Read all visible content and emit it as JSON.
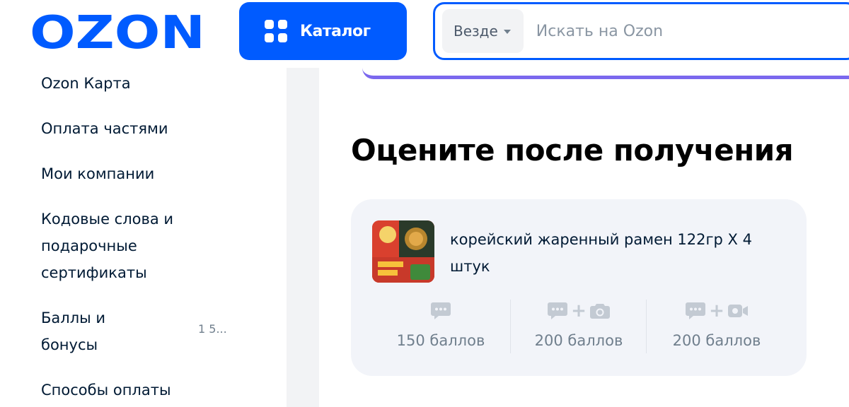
{
  "header": {
    "logo_text": "OZON",
    "catalog_label": "Каталог",
    "search_scope": "Везде",
    "search_placeholder": "Искать на Ozon"
  },
  "sidebar": {
    "items": [
      {
        "label": "Ozon Карта"
      },
      {
        "label": "Оплата частями"
      },
      {
        "label": "Мои компании"
      },
      {
        "label": "Кодовые слова и подарочные сертификаты"
      },
      {
        "label": "Баллы и бонусы",
        "count": "1 5..."
      },
      {
        "label": "Способы оплаты"
      }
    ]
  },
  "main": {
    "title": "Оцените после получения",
    "product": {
      "name": "корейский жаренный рамен 122гр X 4 штук",
      "rewards": [
        {
          "icon": "comment-icon",
          "points": "150 баллов"
        },
        {
          "icon": "comment-plus-camera-icon",
          "points": "200 баллов"
        },
        {
          "icon": "comment-plus-video-icon",
          "points": "200 баллов"
        }
      ]
    }
  },
  "colors": {
    "brand": "#005bff",
    "accent_line": "#7b68ee",
    "card_bg": "#f2f4f9",
    "muted_text": "#707f8d",
    "icon_gray": "#c3cad3"
  }
}
